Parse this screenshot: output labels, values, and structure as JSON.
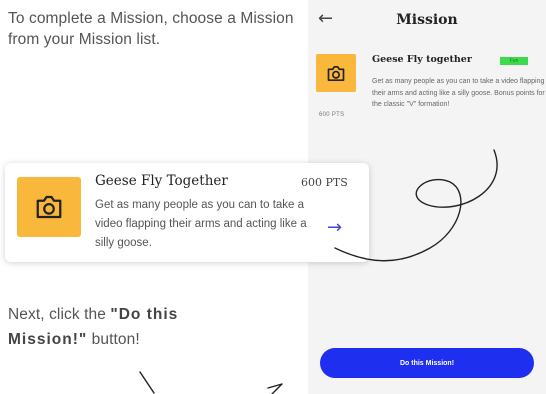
{
  "instructions": {
    "step1": "To complete a Mission, choose a Mission from your Mission list.",
    "step2_prefix": "Next, click the ",
    "step2_bold": "\"Do this Mission!\"",
    "step2_suffix": " button!"
  },
  "phone": {
    "back_icon": "back-arrow-icon",
    "title": "Mission",
    "mission": {
      "name": "Geese Fly together",
      "tag": "Fun",
      "points": "600 PTS",
      "description": "Get as many people as you can to take a video flapping their arms and acting like a silly goose. Bonus points for the classic \"V\" formation!"
    },
    "button_label": "Do this Mission!"
  },
  "mission_card": {
    "icon": "camera-icon",
    "name": "Geese Fly Together",
    "points": "600 PTS",
    "description": "Get as many people as you can to take a video flapping their arms and acting like a silly goose.",
    "arrow_icon": "arrow-right-icon"
  },
  "colors": {
    "icon_bg": "#f9b73c",
    "button_bg": "#1f2ff0",
    "tag_bg": "#3ddb4b",
    "arrow": "#3b4bd8"
  }
}
